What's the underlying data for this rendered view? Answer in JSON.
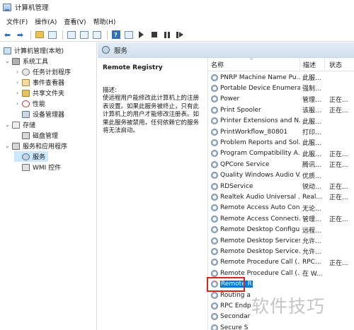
{
  "window": {
    "title": "计算机管理"
  },
  "menu": [
    "文件(F)",
    "操作(A)",
    "查看(V)",
    "帮助(H)"
  ],
  "tree": {
    "root": "计算机管理(本地)",
    "items": [
      {
        "label": "系统工具",
        "level": 1,
        "expander": "⌄",
        "icon": "tools-icon"
      },
      {
        "label": "任务计划程序",
        "level": 2,
        "expander": "›",
        "icon": "clock-icon"
      },
      {
        "label": "事件查看器",
        "level": 2,
        "expander": "›",
        "icon": "event-viewer-icon"
      },
      {
        "label": "共享文件夹",
        "level": 2,
        "expander": "›",
        "icon": "share-folder-icon"
      },
      {
        "label": "性能",
        "level": 2,
        "expander": "›",
        "icon": "performance-icon"
      },
      {
        "label": "设备管理器",
        "level": 2,
        "expander": "",
        "icon": "device-manager-icon"
      },
      {
        "label": "存储",
        "level": 1,
        "expander": "⌄",
        "icon": "storage-icon"
      },
      {
        "label": "磁盘管理",
        "level": 2,
        "expander": "",
        "icon": "disk-icon"
      },
      {
        "label": "服务和应用程序",
        "level": 1,
        "expander": "⌄",
        "icon": "services-apps-icon"
      },
      {
        "label": "服务",
        "level": 2,
        "expander": "",
        "icon": "gear-icon",
        "selected": true
      },
      {
        "label": "WMI 控件",
        "level": 2,
        "expander": "",
        "icon": "wmi-icon"
      }
    ]
  },
  "panel": {
    "title": "服务"
  },
  "description": {
    "service_name": "Remote Registry",
    "label": "描述:",
    "text": "使远程用户能修改此计算机上的注册表设置。如果此服务被终止，只有此计算机上的用户才能修改注册表。如果此服务被禁用，任何依赖它的服务将无法启动。"
  },
  "columns": {
    "name": "名称",
    "desc": "描述",
    "status": "状态"
  },
  "services": [
    {
      "name": "PNRP Machine Name Pu...",
      "desc": "此服...",
      "status": ""
    },
    {
      "name": "Portable Device Enumera...",
      "desc": "强制...",
      "status": ""
    },
    {
      "name": "Power",
      "desc": "管理...",
      "status": "正在..."
    },
    {
      "name": "Print Spooler",
      "desc": "该服...",
      "status": "正在..."
    },
    {
      "name": "Printer Extensions and N...",
      "desc": "此服...",
      "status": ""
    },
    {
      "name": "PrintWorkflow_80801",
      "desc": "打印...",
      "status": ""
    },
    {
      "name": "Problem Reports and Sol...",
      "desc": "此服...",
      "status": ""
    },
    {
      "name": "Program Compatibility A...",
      "desc": "此服...",
      "status": "正在..."
    },
    {
      "name": "QPCore Service",
      "desc": "腾讯...",
      "status": "正在..."
    },
    {
      "name": "Quality Windows Audio V...",
      "desc": "优质...",
      "status": ""
    },
    {
      "name": "RDService",
      "desc": "锐动...",
      "status": "正在..."
    },
    {
      "name": "Realtek Audio Universal ...",
      "desc": "Real...",
      "status": "正在..."
    },
    {
      "name": "Remote Access Auto Con...",
      "desc": "无论...",
      "status": ""
    },
    {
      "name": "Remote Access Connecti...",
      "desc": "管理...",
      "status": "正在..."
    },
    {
      "name": "Remote Desktop Configu...",
      "desc": "远程...",
      "status": ""
    },
    {
      "name": "Remote Desktop Services",
      "desc": "允许...",
      "status": ""
    },
    {
      "name": "Remote Desktop Service...",
      "desc": "允许...",
      "status": ""
    },
    {
      "name": "Remote Procedure Call (...",
      "desc": "RPC...",
      "status": "正在..."
    },
    {
      "name": "Remote Procedure Call (...",
      "desc": "在 W...",
      "status": ""
    },
    {
      "name": "Remote R",
      "desc": "",
      "status": "",
      "selected": true
    },
    {
      "name": "Routing a",
      "desc": "",
      "status": ""
    },
    {
      "name": "RPC Endp",
      "desc": "",
      "status": ""
    },
    {
      "name": "Secondar",
      "desc": "",
      "status": ""
    },
    {
      "name": "Secure S",
      "desc": "",
      "status": ""
    }
  ],
  "watermark": "软件技巧",
  "colors": {
    "selection": "#0078d7",
    "tree_selection": "#cce8ff",
    "highlight_box": "#d9261c",
    "header_band": "#dbe6f2"
  }
}
